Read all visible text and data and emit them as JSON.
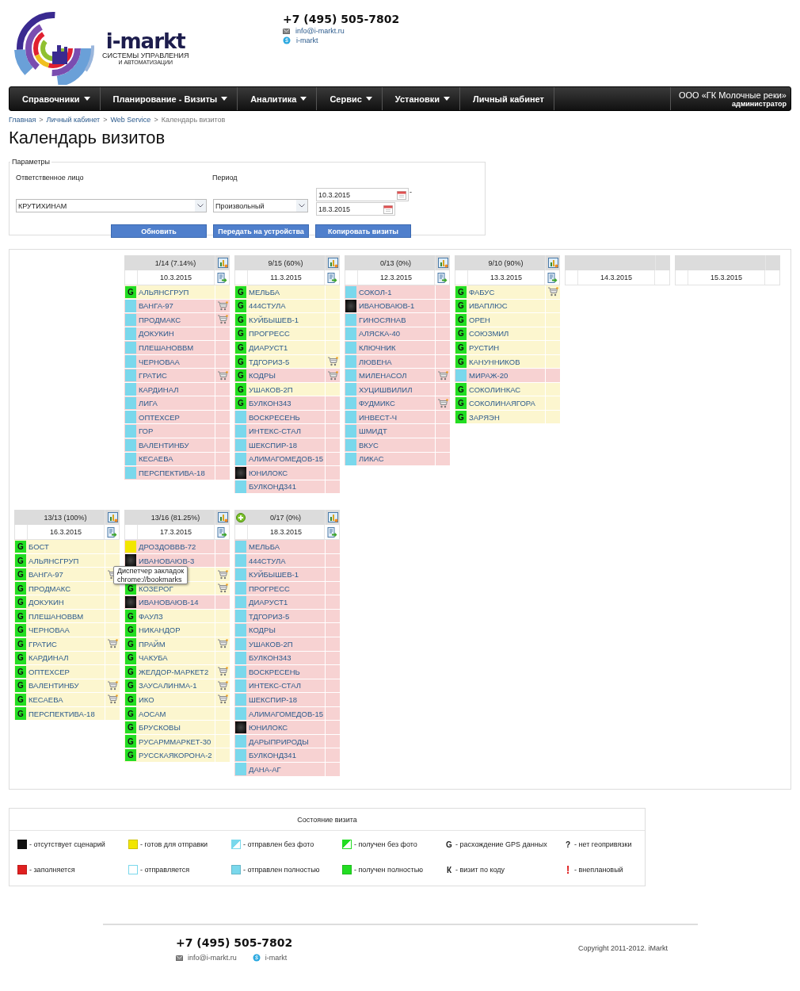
{
  "header": {
    "brand": "i-markt",
    "tagline_1": "СИСТЕМЫ УПРАВЛЕНИЯ",
    "tagline_2": "И АВТОМАТИЗАЦИИ",
    "phone": "+7 (495) 505-7802",
    "email": "info@i-markt.ru",
    "skype": "i-markt"
  },
  "nav": {
    "items": [
      {
        "label": "Справочники",
        "dropdown": true
      },
      {
        "label": "Планирование - Визиты",
        "dropdown": true
      },
      {
        "label": "Аналитика",
        "dropdown": true
      },
      {
        "label": "Сервис",
        "dropdown": true
      },
      {
        "label": "Установки",
        "dropdown": true
      },
      {
        "label": "Личный кабинет",
        "dropdown": false
      }
    ],
    "company": "ООО «ГК Молочные реки»",
    "role": "администратор"
  },
  "breadcrumb": {
    "links": [
      "Главная",
      "Личный кабинет",
      "Web Service"
    ],
    "separator": ">",
    "current": "Календарь визитов"
  },
  "title": "Календарь визитов",
  "params": {
    "legend": "Параметры",
    "responsible": {
      "label": "Ответственное лицо",
      "value": "КРУТИХИНАМ"
    },
    "period": {
      "label": "Период",
      "value": "Произвольный",
      "from": "10.3.2015",
      "to": "18.3.2015",
      "separator": "-"
    },
    "buttons": [
      "Обновить",
      "Передать на устройства",
      "Копировать визиты"
    ]
  },
  "calendar": {
    "weeks": [
      {
        "days": [
          {
            "summary": "1/14 (7.14%)",
            "date": "10.3.2015",
            "tools": true,
            "add_button": false,
            "visits": [
              {
                "kind": "received",
                "flag": "G",
                "name": "АЛЬЯНСГРУП",
                "done": true,
                "cart": false
              },
              {
                "kind": "sent",
                "name": "ВАНГА-97",
                "done": false,
                "cart": true
              },
              {
                "kind": "sent",
                "name": "ПРОДМАКС",
                "done": false,
                "cart": true
              },
              {
                "kind": "sent",
                "name": "ДОКУКИН",
                "done": false,
                "cart": false
              },
              {
                "kind": "sent",
                "name": "ПЛЕШАНОВВМ",
                "done": false,
                "cart": false
              },
              {
                "kind": "sent",
                "name": "ЧЕРНОВАА",
                "done": false,
                "cart": false
              },
              {
                "kind": "sent",
                "name": "ГРАТИС",
                "done": false,
                "cart": true
              },
              {
                "kind": "sent",
                "name": "КАРДИНАЛ",
                "done": false,
                "cart": false
              },
              {
                "kind": "sent",
                "name": "ЛИГА",
                "done": false,
                "cart": false
              },
              {
                "kind": "sent",
                "name": "ОПТЕХСЕР",
                "done": false,
                "cart": false
              },
              {
                "kind": "sent",
                "name": "ГОР",
                "done": false,
                "cart": false
              },
              {
                "kind": "sent",
                "name": "ВАЛЕНТИНБУ",
                "done": false,
                "cart": false
              },
              {
                "kind": "sent",
                "name": "КЕСАЕВА",
                "done": false,
                "cart": false
              },
              {
                "kind": "sent",
                "name": "ПЕРСПЕКТИВА-18",
                "done": false,
                "cart": false
              }
            ]
          },
          {
            "summary": "9/15 (60%)",
            "date": "11.3.2015",
            "tools": true,
            "add_button": false,
            "visits": [
              {
                "kind": "received",
                "flag": "G",
                "name": "МЕЛЬБА",
                "done": true,
                "cart": false
              },
              {
                "kind": "received",
                "flag": "G",
                "name": "444СТУЛА",
                "done": true,
                "cart": false
              },
              {
                "kind": "received",
                "flag": "G",
                "name": "КУЙБЫШЕВ-1",
                "done": true,
                "cart": false
              },
              {
                "kind": "received",
                "flag": "G",
                "name": "ПРОГРЕСС",
                "done": true,
                "cart": false
              },
              {
                "kind": "received",
                "flag": "G",
                "name": "ДИАРУСТ1",
                "done": true,
                "cart": false
              },
              {
                "kind": "received",
                "flag": "G",
                "name": "ТДГОРИЗ-5",
                "done": true,
                "cart": true
              },
              {
                "kind": "received",
                "flag": "G",
                "name": "КОДРЫ",
                "done": false,
                "cart": true
              },
              {
                "kind": "received",
                "flag": "G",
                "name": "УШАКОВ-2П",
                "done": true,
                "cart": false
              },
              {
                "kind": "received",
                "flag": "G",
                "name": "БУЛКОН343",
                "done": false,
                "cart": false
              },
              {
                "kind": "sent",
                "name": "ВОСКРЕСЕНЬ",
                "done": false,
                "cart": false
              },
              {
                "kind": "sent",
                "name": "ИНТЕКС-СТАЛ",
                "done": false,
                "cart": false
              },
              {
                "kind": "sent",
                "name": "ШЕКСПИР-18",
                "done": false,
                "cart": false
              },
              {
                "kind": "sent",
                "name": "АЛИМАГОМЕДОВ-15",
                "done": false,
                "cart": false
              },
              {
                "kind": "no_script",
                "name": "ЮНИЛОКС",
                "done": false,
                "cart": false
              },
              {
                "kind": "sent",
                "name": "БУЛКОНД341",
                "done": false,
                "cart": false
              }
            ]
          },
          {
            "summary": "0/13 (0%)",
            "date": "12.3.2015",
            "tools": true,
            "add_button": false,
            "visits": [
              {
                "kind": "sent",
                "name": "СОКОЛ-1",
                "done": false,
                "cart": false
              },
              {
                "kind": "no_script",
                "name": "ИВАНОВАЮВ-1",
                "done": false,
                "cart": false
              },
              {
                "kind": "sent",
                "name": "ГИНОСЯНАВ",
                "done": false,
                "cart": false
              },
              {
                "kind": "sent",
                "name": "АЛЯСКА-40",
                "done": false,
                "cart": false
              },
              {
                "kind": "sent",
                "name": "КЛЮЧНИК",
                "done": false,
                "cart": false
              },
              {
                "kind": "sent",
                "name": "ЛЮВЕНА",
                "done": false,
                "cart": false
              },
              {
                "kind": "sent",
                "name": "МИЛЕНАСОЛ",
                "done": false,
                "cart": true
              },
              {
                "kind": "sent",
                "name": "ХУЦИШВИЛИЛ",
                "done": false,
                "cart": false
              },
              {
                "kind": "sent",
                "name": "ФУДМИКС",
                "done": false,
                "cart": true
              },
              {
                "kind": "sent",
                "name": "ИНВЕСТ-Ч",
                "done": false,
                "cart": false
              },
              {
                "kind": "sent",
                "name": "ШМИДТ",
                "done": false,
                "cart": false
              },
              {
                "kind": "sent",
                "name": "ВКУС",
                "done": false,
                "cart": false
              },
              {
                "kind": "sent",
                "name": "ЛИКАС",
                "done": false,
                "cart": false
              }
            ]
          },
          {
            "summary": "9/10 (90%)",
            "date": "13.3.2015",
            "tools": true,
            "add_button": false,
            "visits": [
              {
                "kind": "received",
                "flag": "G",
                "name": "ФАБУС",
                "done": true,
                "cart": true
              },
              {
                "kind": "received",
                "flag": "G",
                "name": "ИВАПЛЮС",
                "done": true,
                "cart": false
              },
              {
                "kind": "received",
                "flag": "G",
                "name": "ОРЕН",
                "done": true,
                "cart": false
              },
              {
                "kind": "received",
                "flag": "G",
                "name": "СОЮЗМИЛ",
                "done": true,
                "cart": false
              },
              {
                "kind": "received",
                "flag": "G",
                "name": "РУСТИН",
                "done": true,
                "cart": false
              },
              {
                "kind": "received",
                "flag": "G",
                "name": "КАНУННИКОВ",
                "done": true,
                "cart": false
              },
              {
                "kind": "sent",
                "name": "МИРАЖ-20",
                "done": false,
                "cart": false
              },
              {
                "kind": "received",
                "flag": "G",
                "name": "СОКОЛИНКАС",
                "done": true,
                "cart": false
              },
              {
                "kind": "received",
                "flag": "G",
                "name": "СОКОЛИНАЯГОРА",
                "done": true,
                "cart": false
              },
              {
                "kind": "received",
                "flag": "G",
                "name": "ЗАРЯЭН",
                "done": true,
                "cart": false
              }
            ]
          },
          {
            "date": "14.3.2015",
            "tools": false,
            "add_button": false
          },
          {
            "date": "15.3.2015",
            "tools": false,
            "add_button": false
          }
        ]
      },
      {
        "days": [
          {
            "summary": "13/13 (100%)",
            "date": "16.3.2015",
            "tools": true,
            "add_button": false,
            "visits": [
              {
                "kind": "received",
                "flag": "G",
                "name": "БОСТ",
                "done": true,
                "cart": false
              },
              {
                "kind": "received",
                "flag": "G",
                "name": "АЛЬЯНСГРУП",
                "done": true,
                "cart": false
              },
              {
                "kind": "received",
                "flag": "G",
                "name": "ВАНГА-97",
                "done": true,
                "cart": true
              },
              {
                "kind": "received",
                "flag": "G",
                "name": "ПРОДМАКС",
                "done": true,
                "cart": false
              },
              {
                "kind": "received",
                "flag": "G",
                "name": "ДОКУКИН",
                "done": true,
                "cart": false
              },
              {
                "kind": "received",
                "flag": "G",
                "name": "ПЛЕШАНОВВМ",
                "done": true,
                "cart": false
              },
              {
                "kind": "received",
                "flag": "G",
                "name": "ЧЕРНОВАА",
                "done": true,
                "cart": false
              },
              {
                "kind": "received",
                "flag": "G",
                "name": "ГРАТИС",
                "done": true,
                "cart": true
              },
              {
                "kind": "received",
                "flag": "G",
                "name": "КАРДИНАЛ",
                "done": true,
                "cart": false
              },
              {
                "kind": "received",
                "flag": "G",
                "name": "ОПТЕХСЕР",
                "done": true,
                "cart": false
              },
              {
                "kind": "received",
                "flag": "G",
                "name": "ВАЛЕНТИНБУ",
                "done": true,
                "cart": true
              },
              {
                "kind": "received",
                "flag": "G",
                "name": "КЕСАЕВА",
                "done": true,
                "cart": true
              },
              {
                "kind": "received",
                "flag": "G",
                "name": "ПЕРСПЕКТИВА-18",
                "done": true,
                "cart": false
              }
            ]
          },
          {
            "summary": "13/16 (81.25%)",
            "date": "17.3.2015",
            "tools": true,
            "add_button": false,
            "visits": [
              {
                "kind": "ready",
                "name": "ДРОЗДОВВВ-72",
                "done": false,
                "cart": false
              },
              {
                "kind": "no_script",
                "name": "ИВАНОВАЮВ-3",
                "done": false,
                "cart": false
              },
              {
                "done": true,
                "cart": true
              },
              {
                "kind": "received",
                "flag": "G",
                "name": "КОЗЕРОГ",
                "done": true,
                "cart": true
              },
              {
                "kind": "no_script",
                "name": "ИВАНОВАЮВ-14",
                "done": false,
                "cart": false
              },
              {
                "kind": "received",
                "flag": "G",
                "name": "ФАУЛЗ",
                "done": true,
                "cart": false
              },
              {
                "kind": "received",
                "flag": "G",
                "name": "НИКАНДОР",
                "done": true,
                "cart": false
              },
              {
                "kind": "received",
                "flag": "G",
                "name": "ПРАЙМ",
                "done": true,
                "cart": true
              },
              {
                "kind": "received",
                "flag": "G",
                "name": "ЧАКУБА",
                "done": true,
                "cart": false
              },
              {
                "kind": "received",
                "flag": "G",
                "name": "ЖЕЛДОР-МАРКЕТ2",
                "done": true,
                "cart": true
              },
              {
                "kind": "received",
                "flag": "G",
                "name": "ЗАУСАЛИНМА-1",
                "done": true,
                "cart": true
              },
              {
                "kind": "received",
                "flag": "G",
                "name": "ИКО",
                "done": true,
                "cart": true
              },
              {
                "kind": "received",
                "flag": "G",
                "name": "АОСАМ",
                "done": true,
                "cart": false
              },
              {
                "kind": "received",
                "flag": "G",
                "name": "БРУСКОВЫ",
                "done": true,
                "cart": false
              },
              {
                "kind": "received",
                "flag": "G",
                "name": "РУСАРММАРКЕТ-30",
                "done": true,
                "cart": false
              },
              {
                "kind": "received",
                "flag": "G",
                "name": "РУССКАЯКОРОНА-2",
                "done": true,
                "cart": false
              }
            ]
          },
          {
            "summary": "0/17 (0%)",
            "date": "18.3.2015",
            "tools": true,
            "add_button": true,
            "visits": [
              {
                "kind": "sent",
                "name": "МЕЛЬБА",
                "done": false,
                "cart": false
              },
              {
                "kind": "sent",
                "name": "444СТУЛА",
                "done": false,
                "cart": false
              },
              {
                "kind": "sent",
                "name": "КУЙБЫШЕВ-1",
                "done": false,
                "cart": false
              },
              {
                "kind": "sent",
                "name": "ПРОГРЕСС",
                "done": false,
                "cart": false
              },
              {
                "kind": "sent",
                "name": "ДИАРУСТ1",
                "done": false,
                "cart": false
              },
              {
                "kind": "sent",
                "name": "ТДГОРИЗ-5",
                "done": false,
                "cart": false
              },
              {
                "kind": "sent",
                "name": "КОДРЫ",
                "done": false,
                "cart": false
              },
              {
                "kind": "sent",
                "name": "УШАКОВ-2П",
                "done": false,
                "cart": false
              },
              {
                "kind": "sent",
                "name": "БУЛКОН343",
                "done": false,
                "cart": false
              },
              {
                "kind": "sent",
                "name": "ВОСКРЕСЕНЬ",
                "done": false,
                "cart": false
              },
              {
                "kind": "sent",
                "name": "ИНТЕКС-СТАЛ",
                "done": false,
                "cart": false
              },
              {
                "kind": "sent",
                "name": "ШЕКСПИР-18",
                "done": false,
                "cart": false
              },
              {
                "kind": "sent",
                "name": "АЛИМАГОМЕДОВ-15",
                "done": false,
                "cart": false
              },
              {
                "kind": "no_script",
                "name": "ЮНИЛОКС",
                "done": false,
                "cart": false
              },
              {
                "kind": "sent",
                "name": "ДАРЫПРИРОДЫ",
                "done": false,
                "cart": false
              },
              {
                "kind": "sent",
                "name": "БУЛКОНД341",
                "done": false,
                "cart": false
              },
              {
                "kind": "sent",
                "name": "ДАНА-АГ",
                "done": false,
                "cart": false
              }
            ]
          }
        ]
      }
    ],
    "tooltip": {
      "title": "Диспетчер закладок",
      "url": "chrome://bookmarks"
    }
  },
  "legend": {
    "title": "Состояние визита",
    "items": [
      {
        "kind": "solid",
        "color": "#111111",
        "label": "- отсутствует сценарий"
      },
      {
        "kind": "solid",
        "color": "#f2e600",
        "label": "- готов для отправки"
      },
      {
        "kind": "half",
        "color": "#7ad8ec",
        "label": "- отправлен без фото"
      },
      {
        "kind": "half",
        "color": "#22dd22",
        "label": "- получен без фото"
      },
      {
        "kind": "letter",
        "symbol": "G",
        "label": "- расхождение GPS данных"
      },
      {
        "kind": "letter",
        "symbol": "?",
        "label": "- нет геопривязки"
      },
      {
        "kind": "solid",
        "color": "#e02020",
        "label": "- заполняется"
      },
      {
        "kind": "outline",
        "color": "#7ad8ec",
        "label": "- отправляется"
      },
      {
        "kind": "solid",
        "color": "#7ad8ec",
        "label": "- отправлен полностью"
      },
      {
        "kind": "solid",
        "color": "#22dd22",
        "label": "- получен полностью"
      },
      {
        "kind": "letter",
        "symbol": "К",
        "label": "- визит по коду"
      },
      {
        "kind": "alert",
        "symbol": "!",
        "label": "- внеплановый"
      }
    ]
  },
  "footer": {
    "phone": "+7 (495) 505-7802",
    "email": "info@i-markt.ru",
    "skype": "i-markt",
    "copyright": "Copyright 2011-2012. iMarkt"
  }
}
